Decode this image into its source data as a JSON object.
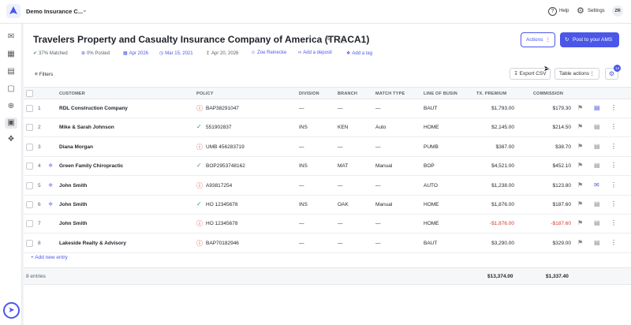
{
  "app": {
    "org_name": "Demo Insurance C...",
    "help_label": "Help",
    "settings_label": "Settings",
    "user_initials": "ZR"
  },
  "statement": {
    "title": "Travelers Property and Casualty Insurance Company of America (TRACA1)",
    "matched": "37% Matched",
    "posted": "0% Posted",
    "period": "Apr 2026",
    "statement_date": "Mar 15, 2021",
    "upload_date": "Apr 20, 2026",
    "owner": "Zoe Reinecke",
    "add_deposit": "Add a deposit",
    "add_tag": "Add a tag"
  },
  "toolbar": {
    "actions_label": "Actions",
    "post_label": "Post to your AMS",
    "filters_label": "Filters",
    "export_label": "Export CSV",
    "table_actions_label": "Table actions",
    "columns_badge": "13"
  },
  "table": {
    "columns": [
      "CUSTOMER",
      "POLICY",
      "DIVISION",
      "BRANCH",
      "MATCH TYPE",
      "LINE OF BUSIN",
      "TX. PREMIUM",
      "COMMISSION"
    ],
    "rows": [
      {
        "num": "1",
        "customer": "RDL Construction Company",
        "policy": "BAP38291047",
        "policy_status": "warning",
        "division": "—",
        "branch": "—",
        "match_type": "—",
        "line": "BAUT",
        "premium": "$1,793.00",
        "commission": "$179.30",
        "tagged": false
      },
      {
        "num": "2",
        "customer": "Mike & Sarah Johnson",
        "policy": "551902837",
        "policy_status": "matched",
        "division": "INS",
        "branch": "KEN",
        "match_type": "Auto",
        "line": "HOME",
        "premium": "$2,145.00",
        "commission": "$214.50",
        "tagged": false
      },
      {
        "num": "3",
        "customer": "Diana Morgan",
        "policy": "UMB 456283719",
        "policy_status": "warning",
        "division": "—",
        "branch": "—",
        "match_type": "—",
        "line": "PUMB",
        "premium": "$387.00",
        "commission": "$38.70",
        "tagged": false
      },
      {
        "num": "4",
        "customer": "Green Family Chiropractic",
        "policy": "BOP2953748162",
        "policy_status": "matched",
        "division": "INS",
        "branch": "MAT",
        "match_type": "Manual",
        "line": "BOP",
        "premium": "$4,521.00",
        "commission": "$452.10",
        "tagged": true
      },
      {
        "num": "5",
        "customer": "John Smith",
        "policy": "A93817254",
        "policy_status": "warning",
        "division": "—",
        "branch": "—",
        "match_type": "—",
        "line": "AUTO",
        "premium": "$1,238.00",
        "commission": "$123.80",
        "tagged": true
      },
      {
        "num": "6",
        "customer": "John Smith",
        "policy": "HO 12345678",
        "policy_status": "matched",
        "division": "INS",
        "branch": "OAK",
        "match_type": "Manual",
        "line": "HOME",
        "premium": "$1,876.00",
        "commission": "$187.60",
        "tagged": true
      },
      {
        "num": "7",
        "customer": "John Smith",
        "policy": "HO 12345678",
        "policy_status": "warning",
        "division": "—",
        "branch": "—",
        "match_type": "—",
        "line": "HOME",
        "premium": "-$1,876.00",
        "commission": "-$187.60",
        "tagged": false
      },
      {
        "num": "8",
        "customer": "Lakeside Realty & Advisory",
        "policy": "BAP70182946",
        "policy_status": "warning",
        "division": "—",
        "branch": "—",
        "match_type": "—",
        "line": "BAUT",
        "premium": "$3,290.00",
        "commission": "$329.00",
        "tagged": false
      }
    ],
    "add_entry_label": "+ Add new entry",
    "footer": {
      "entries": "8 entries",
      "premium_total": "$13,374.00",
      "commission_total": "$1,337.40"
    }
  },
  "colors": {
    "accent": "#4b57e6",
    "success": "#2e9e5a",
    "danger": "#d33a2c"
  }
}
